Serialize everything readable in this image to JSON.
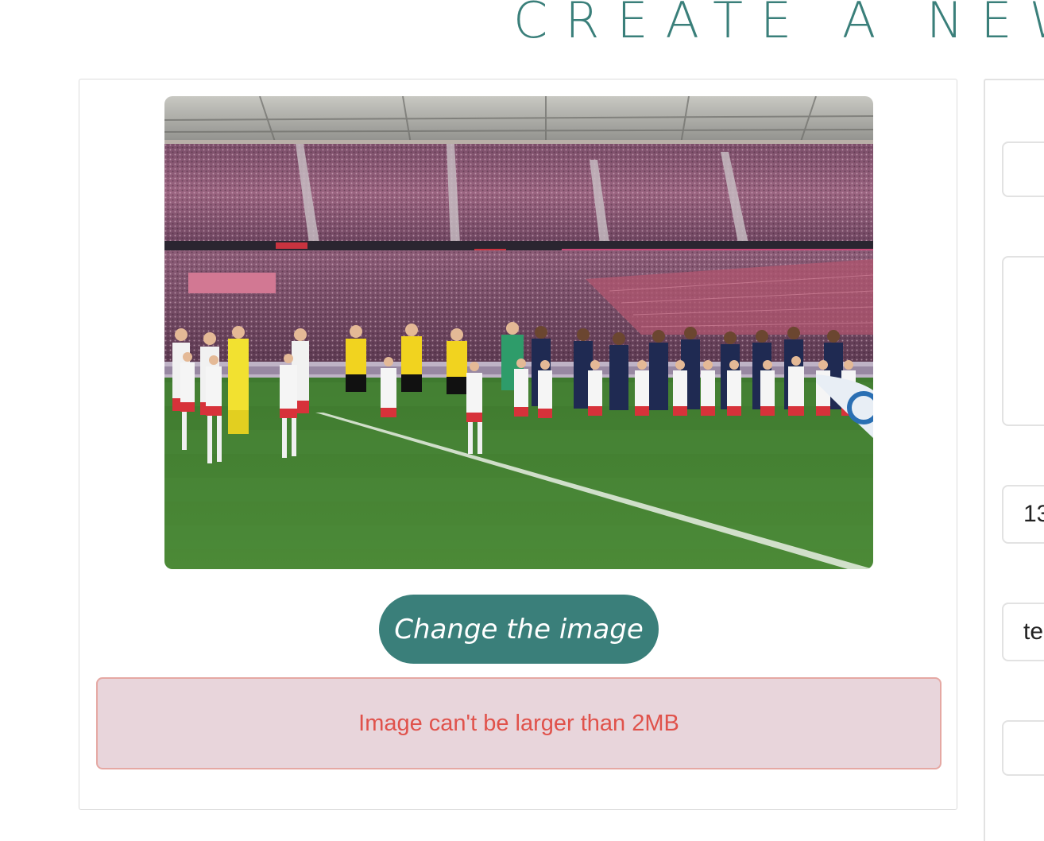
{
  "header": {
    "title": "Create a new fr"
  },
  "upload": {
    "image_alt": "Stadium photo of football teams lined up on the pitch with mascots",
    "change_button_label": "Change the image",
    "error_message": "Image can't be larger than 2MB"
  },
  "form": {
    "field1_value": "",
    "field2_value": "",
    "field3_value": "13",
    "field4_value": "te",
    "field5_value": ""
  },
  "colors": {
    "accent": "#3a7f7a",
    "error_text": "#e0524b",
    "error_bg": "#e8d5db",
    "error_border": "#e5a8a3"
  }
}
